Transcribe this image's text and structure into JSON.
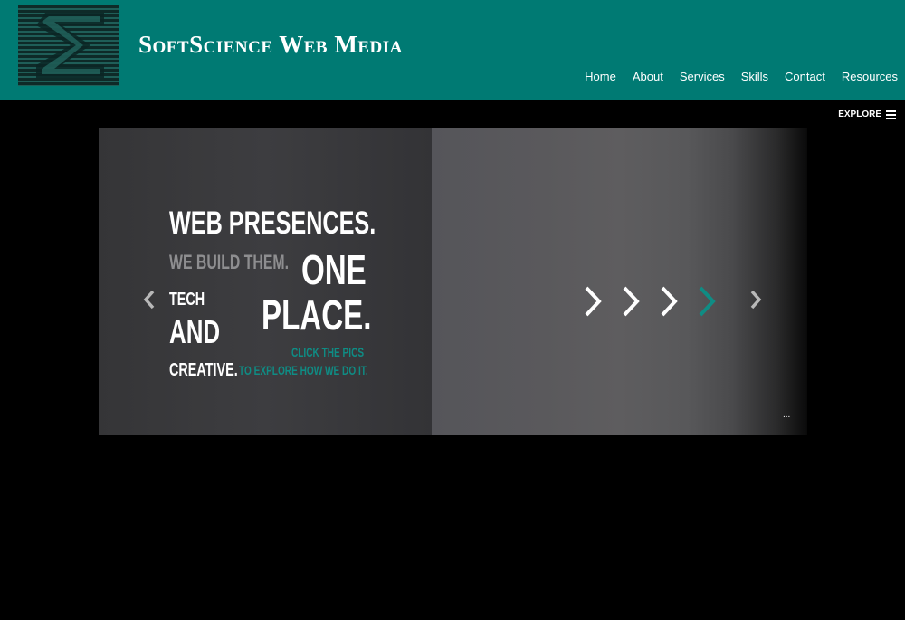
{
  "header": {
    "site_title": "SoftScience Web Media",
    "brand_color": "#007a73",
    "logo_icon": "striped-s-logo"
  },
  "nav": {
    "items": [
      {
        "label": "Home"
      },
      {
        "label": "About"
      },
      {
        "label": "Services"
      },
      {
        "label": "Skills"
      },
      {
        "label": "Contact"
      },
      {
        "label": "Resources"
      }
    ]
  },
  "explore": {
    "label": "EXPLORE",
    "icon": "hamburger-menu-icon"
  },
  "slider": {
    "headline": "WEB PRESENCES.",
    "subline": "WE BUILD THEM.",
    "one": "ONE",
    "tech": "TECH",
    "place": "PLACE.",
    "and": "AND",
    "click": "CLICK THE PICS",
    "creative": "CREATIVE.",
    "explore_text": "TO EXPLORE HOW WE DO IT.",
    "dots": "...",
    "accent_color": "#0f8c84",
    "prev_icon": "chevron-left-icon",
    "next_icon": "chevron-right-icon",
    "decor_icon": "chevrons-right-icon"
  }
}
